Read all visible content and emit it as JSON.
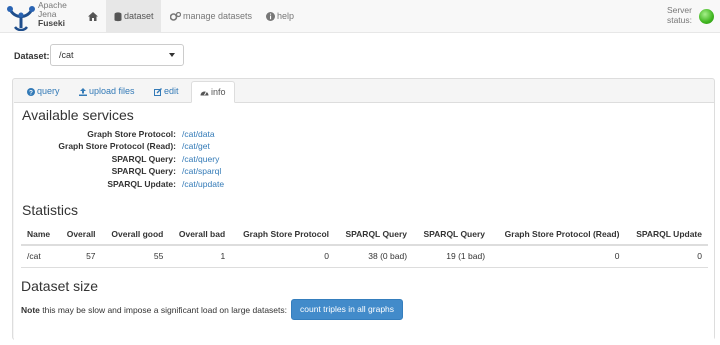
{
  "brand": {
    "line1": "Apache",
    "line2": "Jena",
    "line3": "Fuseki"
  },
  "nav": {
    "home_icon": "home-icon",
    "dataset": "dataset",
    "manage": "manage datasets",
    "help": "help"
  },
  "server": {
    "label_line1": "Server",
    "label_line2": "status:",
    "status_color": "#3fb51f"
  },
  "dataset_selector": {
    "label": "Dataset:",
    "value": "/cat"
  },
  "tabs": [
    {
      "label": "query",
      "icon": "question-circle-icon"
    },
    {
      "label": "upload files",
      "icon": "upload-icon"
    },
    {
      "label": "edit",
      "icon": "edit-icon"
    },
    {
      "label": "info",
      "icon": "dashboard-icon",
      "active": true
    }
  ],
  "services": {
    "title": "Available services",
    "rows": [
      {
        "name": "Graph Store Protocol:",
        "link": "/cat/data"
      },
      {
        "name": "Graph Store Protocol (Read):",
        "link": "/cat/get"
      },
      {
        "name": "SPARQL Query:",
        "link": "/cat/query"
      },
      {
        "name": "SPARQL Query:",
        "link": "/cat/sparql"
      },
      {
        "name": "SPARQL Update:",
        "link": "/cat/update"
      }
    ]
  },
  "statistics": {
    "title": "Statistics",
    "headers": [
      "Name",
      "Overall",
      "Overall good",
      "Overall bad",
      "Graph Store Protocol",
      "SPARQL Query",
      "SPARQL Query",
      "Graph Store Protocol (Read)",
      "SPARQL Update"
    ],
    "rows": [
      [
        "/cat",
        "57",
        "55",
        "1",
        "0",
        "38 (0 bad)",
        "19 (1 bad)",
        "0",
        "0"
      ]
    ]
  },
  "dataset_size": {
    "title": "Dataset size",
    "note_bold": "Note",
    "note_text": " this may be slow and impose a significant load on large datasets:",
    "button": "count triples in all graphs"
  }
}
